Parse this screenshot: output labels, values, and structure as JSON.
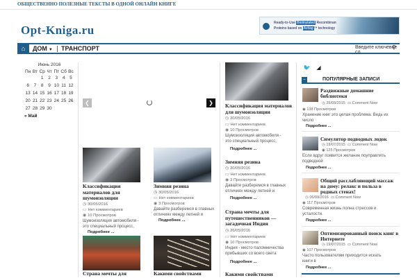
{
  "topbar": {
    "tagline": "ОБЩЕСТВЕННО ПОЛЕЗНЫЕ ТЕКСТЫ В ОДНОЙ ОНЛАЙН КНИГЕ"
  },
  "logo": "Opt-Kniga.ru",
  "ad": {
    "line1_pre": "Ready-to-Use ",
    "line1_hl": "Biotinylated",
    "line1_post": " Recombinant",
    "line2_pre": "Proteins based on ",
    "line2_hl": "Avitag",
    "line2_post": "™ technology"
  },
  "nav": {
    "home_icon": "home-icon",
    "item1": "ДОМ",
    "item2": "ТРАНСПОРТ",
    "search_placeholder": "Введите ключевое сл",
    "search_icon": "magnifier-icon"
  },
  "calendar": {
    "caption": "Июнь 2016",
    "weekdays": [
      "Пн",
      "Вт",
      "Ср",
      "Чт",
      "Пт",
      "Сб",
      "Вс"
    ],
    "days": [
      "",
      "",
      "1",
      "2",
      "3",
      "4",
      "5",
      "6",
      "7",
      "8",
      "9",
      "10",
      "11",
      "12",
      "13",
      "14",
      "15",
      "16",
      "17",
      "18",
      "19",
      "20",
      "21",
      "22",
      "23",
      "24",
      "25",
      "26",
      "27",
      "28",
      "29",
      "30",
      "",
      "",
      ""
    ],
    "prev": "« Май"
  },
  "posts": [
    {
      "title": "Классификация материалов для шумоизоляции",
      "date": "30/05/2016",
      "comments": "Нет комментариев",
      "views": "10 Просмотров",
      "excerpt": "Шумоизоляция автомобиля - это специальный процесс,",
      "more": "Подробнее ..."
    },
    {
      "title": "Зимняя резина",
      "date": "30/05/2016",
      "comments": "Нет комментариев",
      "views": "3 Просмотров",
      "excerpt": "Давайте разберемся в главных отличиях между летней и",
      "more": "Подробнее ..."
    },
    {
      "title": "Классификация материалов для шумоизоляции",
      "date": "30/05/2016",
      "comments": "Нет комментариев",
      "views": "10 Просмотров",
      "excerpt": "Шумоизоляция автомобиля - это специальный процесс,",
      "more": "Подробнее ..."
    },
    {
      "title": "Зимняя резина",
      "date": "30/05/2016",
      "comments": "Нет комментариев",
      "views": "3 Просмотров",
      "excerpt": "Давайте разберемся в главных отличиях между летней и",
      "more": "Подробнее ..."
    },
    {
      "title": "Страна мечты для путешественников — загадочная Индия",
      "date": "26/05/2016",
      "comments": "Нет комментариев",
      "views": "10 Просмотров",
      "excerpt": "Индия - место паломничества прибывших со всего света",
      "more": "Подробнее ..."
    },
    {
      "title": "Страна мечты для",
      "title2": "Какими свойствами",
      "title3": "Какими свойствами"
    }
  ],
  "sidebar": {
    "popular_title": "ПОПУЛЯРНЫЕ ЗАПИСИ",
    "twitter_icon": "twitter-icon",
    "rss_icon": "rss-icon",
    "items": [
      {
        "title": "Раздвижные домашние библиотеки",
        "date": "25/03/2015",
        "comments": "Comment Now",
        "views": "138 Просмотров",
        "excerpt": "Хранение книг это целая проблема. Ведь их число",
        "more": "Подробнее ..."
      },
      {
        "title": "Симулятор подводных лодок",
        "date": "19/07/2015",
        "comments": "Comment Now",
        "views": "125 Просмотров",
        "excerpt": "Если вдруг появится желание поуправлять подводной",
        "more": "Подробнее ..."
      },
      {
        "title": "Общий расслабляющий массаж на дому: релакс и польза в родных стенах!",
        "date": "06/03/2016",
        "comments": "Comment Now",
        "views": "117 Просмотров",
        "excerpt": "Современная жизнь полна стрессов и усталости.",
        "more": "Подробнее ..."
      },
      {
        "title": "Оптимизированный поиск книг в Интернете",
        "date": "19/07/2015",
        "comments": "Comment Now",
        "views": "107 Просмотров",
        "excerpt": "Часто пользователям приходится искать книги в",
        "more": "Подробнее ..."
      }
    ]
  }
}
